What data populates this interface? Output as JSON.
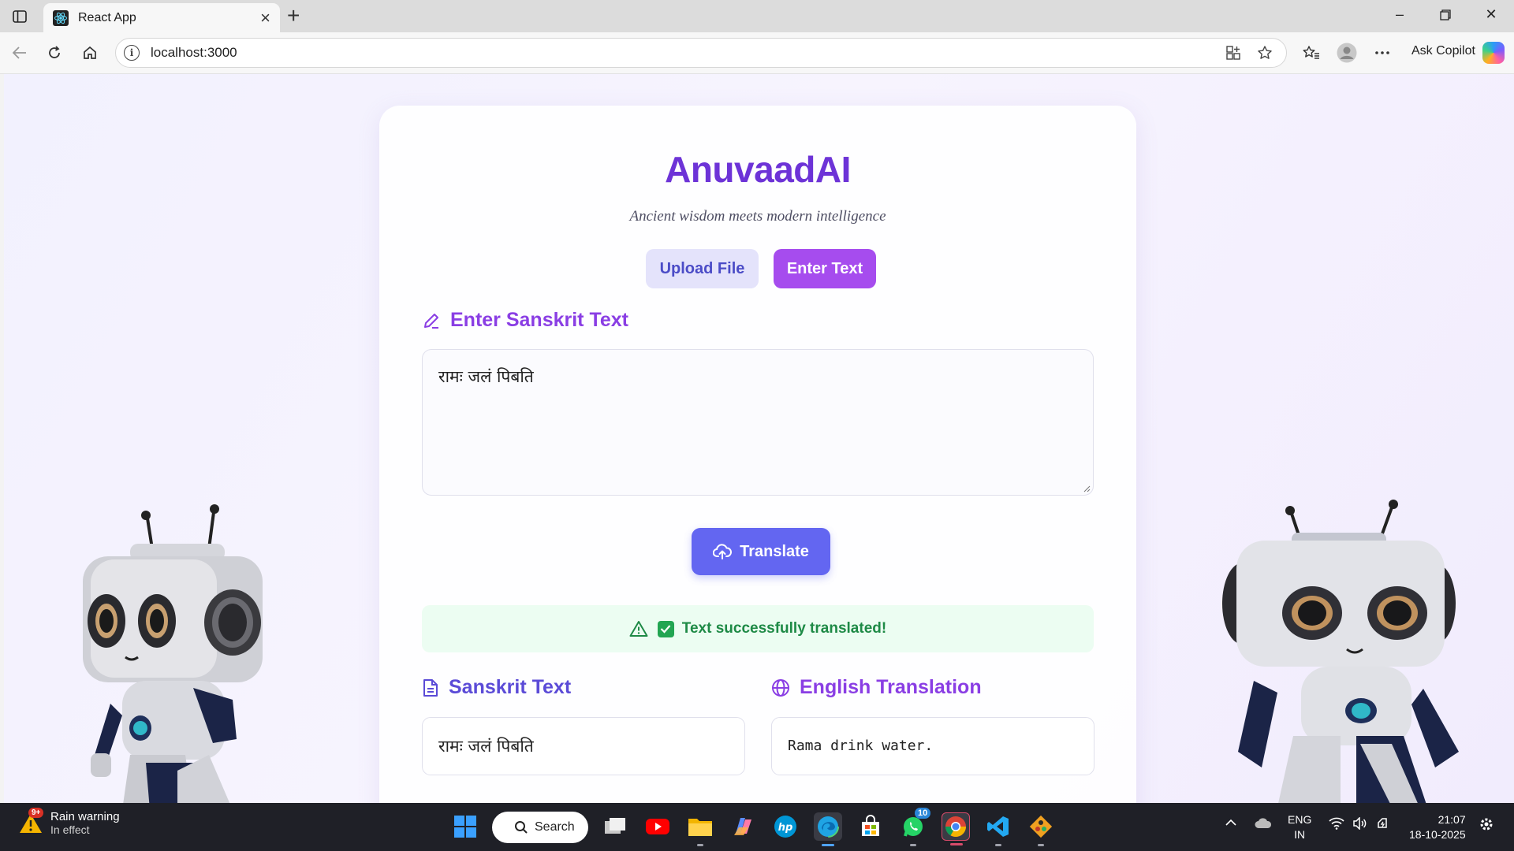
{
  "browser": {
    "tab_title": "React App",
    "url": "localhost:3000",
    "copilot_label": "Ask Copilot"
  },
  "app": {
    "title": "AnuvaadAI",
    "subtitle": "Ancient wisdom meets modern intelligence",
    "mode_buttons": {
      "upload": "Upload File",
      "enter": "Enter Text"
    },
    "input_heading": "Enter Sanskrit Text",
    "input_value": "रामः जलं पिबति",
    "translate_label": "Translate",
    "success_message": "Text successfully translated!",
    "output": {
      "sanskrit_heading": "Sanskrit Text",
      "sanskrit_value": "रामः जलं पिबति",
      "english_heading": "English Translation",
      "english_value": "Rama drink water."
    },
    "colors": {
      "title": "#6d33d7",
      "accent": "#a64cee",
      "translate": "#6366f1",
      "success": "#1e8a46"
    }
  },
  "taskbar": {
    "weather_badge": "9+",
    "weather_title": "Rain warning",
    "weather_sub": "In effect",
    "search_label": "Search",
    "whatsapp_badge": "10",
    "lang_line1": "ENG",
    "lang_line2": "IN",
    "time": "21:07",
    "date": "18-10-2025"
  }
}
